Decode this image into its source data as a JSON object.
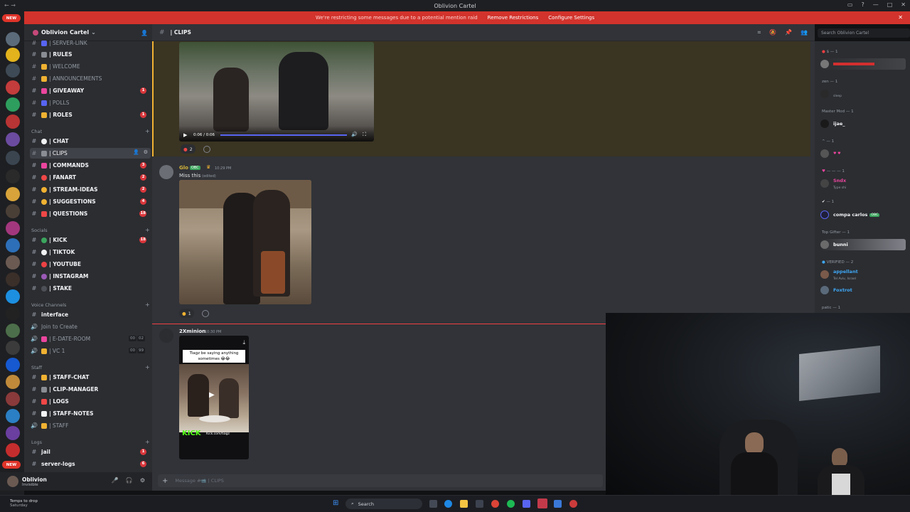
{
  "window": {
    "title": "Oblivion Cartel"
  },
  "banner": {
    "message": "We're restricting some messages due to a potential mention raid",
    "remove_label": "Remove Restrictions",
    "configure_label": "Configure Settings"
  },
  "rail": {
    "new_badge": "NEW",
    "new_badge_bottom": "NEW"
  },
  "guild": {
    "name": "Oblivion Cartel"
  },
  "categories": {
    "chat": "Chat",
    "socials": "Socials",
    "voice": "Voice Channels",
    "staff": "Staff",
    "logs": "Logs"
  },
  "channels": {
    "server_link": "| SERVER-LINK",
    "rules": "| RULES",
    "welcome": "| WELCOME",
    "announcements": "| ANNOUNCEMENTS",
    "giveaway": "| GIVEAWAY",
    "polls": "| POLLS",
    "roles": "| ROLES",
    "chat": "| CHAT",
    "clips": "| CLIPS",
    "commands": "| COMMANDS",
    "fanart": "| FANART",
    "stream_ideas": "| STREAM-IDEAS",
    "suggestions": "| SUGGESTIONS",
    "questions": "| QUESTIONS",
    "kick": "| KICK",
    "tiktok": "| TIKTOK",
    "youtube": "| YOUTUBE",
    "instagram": "| INSTAGRAM",
    "stake": "| STAKE",
    "interface": "interface",
    "join_to_create": "Join to Create",
    "edate_room": "| E-DATE-ROOM",
    "vc1": "| VC 1",
    "staff_chat": "| STAFF-CHAT",
    "clip_manager": "| CLIP-MANAGER",
    "logs": "| LOGS",
    "staff_notes": "| STAFF-NOTES",
    "staff": "| STAFF",
    "jail": "jail",
    "server_logs": "server-logs"
  },
  "badges": {
    "giveaway": "1",
    "roles": "1",
    "commands": "3",
    "fanart": "2",
    "stream_ideas": "2",
    "suggestions": "4",
    "questions": "18",
    "kick": "18",
    "jail": "1",
    "server_logs": "6"
  },
  "voice_counts": {
    "edate_a": "00",
    "edate_b": "02",
    "vc1_a": "00",
    "vc1_b": "99"
  },
  "user": {
    "name": "Oblivion",
    "status": "Invisible"
  },
  "chat": {
    "channel": "| CLIPS",
    "composer_placeholder": "Message #📹 | CLIPS",
    "search_placeholder": "Search Oblivion Cartel"
  },
  "video": {
    "time": "0:06 / 0:06"
  },
  "messages": [
    {
      "author": "Glo",
      "tag": "OBC",
      "time": "10:29 PM",
      "text": "Miss this",
      "edited": "(edited)",
      "reaction_count": "1"
    },
    {
      "author": "2Xminion",
      "time": "10:30 PM",
      "overlay_text": "Tiagz be saying anything sometimes 😂😂",
      "watermark": "KICK",
      "watermark_url": "Kick.com/tiagz"
    }
  ],
  "highlight_reaction_count": "2",
  "members": {
    "roles": {
      "r1": "$ — 1",
      "r2": "zen — 1",
      "r3": "Master Mod — 1",
      "r4": "^ — 1",
      "r5": "— — — 1",
      "r6": "— 1",
      "r7": "Top Gifter — 1",
      "r8": "VERIFIED — 2",
      "r9": "patic — 1"
    },
    "list": {
      "m2_status": "sleep",
      "m3": "ijae_",
      "m4": "Sndx",
      "m4_status": "Type shi",
      "m5": "compa carlos",
      "m5_tag": "OBC",
      "m6": "bunni",
      "m7": "appellant",
      "m7_status": "Tel Aviv, Israel",
      "m8": "Foxtrot"
    }
  },
  "taskbar": {
    "weather_line1": "Temps to drop",
    "weather_line2": "Saturday",
    "search_label": "Search"
  },
  "colors": {
    "banner": "#d2332c",
    "accent_highlight": "#f0b232",
    "badge": "#da373c",
    "glo_name": "#d4b43a",
    "minion_name": "#f2f3f5",
    "verified_blue": "#3fa7f5",
    "pink_role": "#eb459e"
  }
}
